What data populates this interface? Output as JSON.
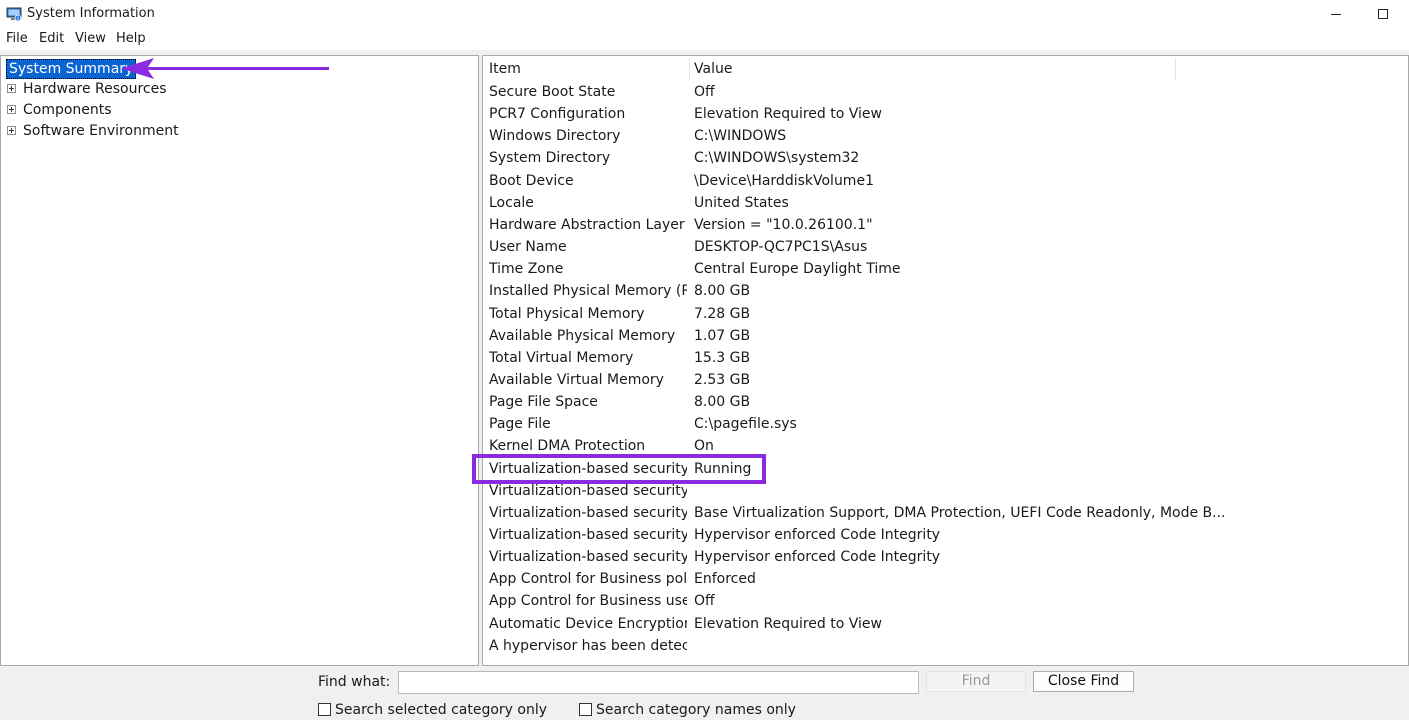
{
  "window": {
    "title": "System Information"
  },
  "menu": [
    "File",
    "Edit",
    "View",
    "Help"
  ],
  "tree": {
    "root": "System Summary",
    "children": [
      "Hardware Resources",
      "Components",
      "Software Environment"
    ]
  },
  "list": {
    "headers": {
      "item": "Item",
      "value": "Value"
    },
    "rows": [
      {
        "item": "Secure Boot State",
        "value": "Off"
      },
      {
        "item": "PCR7 Configuration",
        "value": "Elevation Required to View"
      },
      {
        "item": "Windows Directory",
        "value": "C:\\WINDOWS"
      },
      {
        "item": "System Directory",
        "value": "C:\\WINDOWS\\system32"
      },
      {
        "item": "Boot Device",
        "value": "\\Device\\HarddiskVolume1"
      },
      {
        "item": "Locale",
        "value": "United States"
      },
      {
        "item": "Hardware Abstraction Layer",
        "value": "Version = \"10.0.26100.1\""
      },
      {
        "item": "User Name",
        "value": "DESKTOP-QC7PC1S\\Asus"
      },
      {
        "item": "Time Zone",
        "value": "Central Europe Daylight Time"
      },
      {
        "item": "Installed Physical Memory (RA...",
        "value": "8.00 GB"
      },
      {
        "item": "Total Physical Memory",
        "value": "7.28 GB"
      },
      {
        "item": "Available Physical Memory",
        "value": "1.07 GB"
      },
      {
        "item": "Total Virtual Memory",
        "value": "15.3 GB"
      },
      {
        "item": "Available Virtual Memory",
        "value": "2.53 GB"
      },
      {
        "item": "Page File Space",
        "value": "8.00 GB"
      },
      {
        "item": "Page File",
        "value": "C:\\pagefile.sys"
      },
      {
        "item": "Kernel DMA Protection",
        "value": "On"
      },
      {
        "item": "Virtualization-based security",
        "value": "Running"
      },
      {
        "item": "Virtualization-based security ...",
        "value": ""
      },
      {
        "item": "Virtualization-based security ...",
        "value": "Base Virtualization Support, DMA Protection, UEFI Code Readonly, Mode B..."
      },
      {
        "item": "Virtualization-based security S...",
        "value": "Hypervisor enforced Code Integrity"
      },
      {
        "item": "Virtualization-based security S...",
        "value": "Hypervisor enforced Code Integrity"
      },
      {
        "item": "App Control for Business policy",
        "value": "Enforced"
      },
      {
        "item": "App Control for Business user ...",
        "value": "Off"
      },
      {
        "item": "Automatic Device Encryption ...",
        "value": "Elevation Required to View"
      },
      {
        "item": "A hypervisor has been detecte...",
        "value": ""
      }
    ]
  },
  "find": {
    "label": "Find what:",
    "input_value": "",
    "find_button": "Find",
    "close_button": "Close Find",
    "check_selected": "Search selected category only",
    "check_names": "Search category names only"
  },
  "colors": {
    "selection": "#0a64d2",
    "annotation": "#8a2be2"
  }
}
